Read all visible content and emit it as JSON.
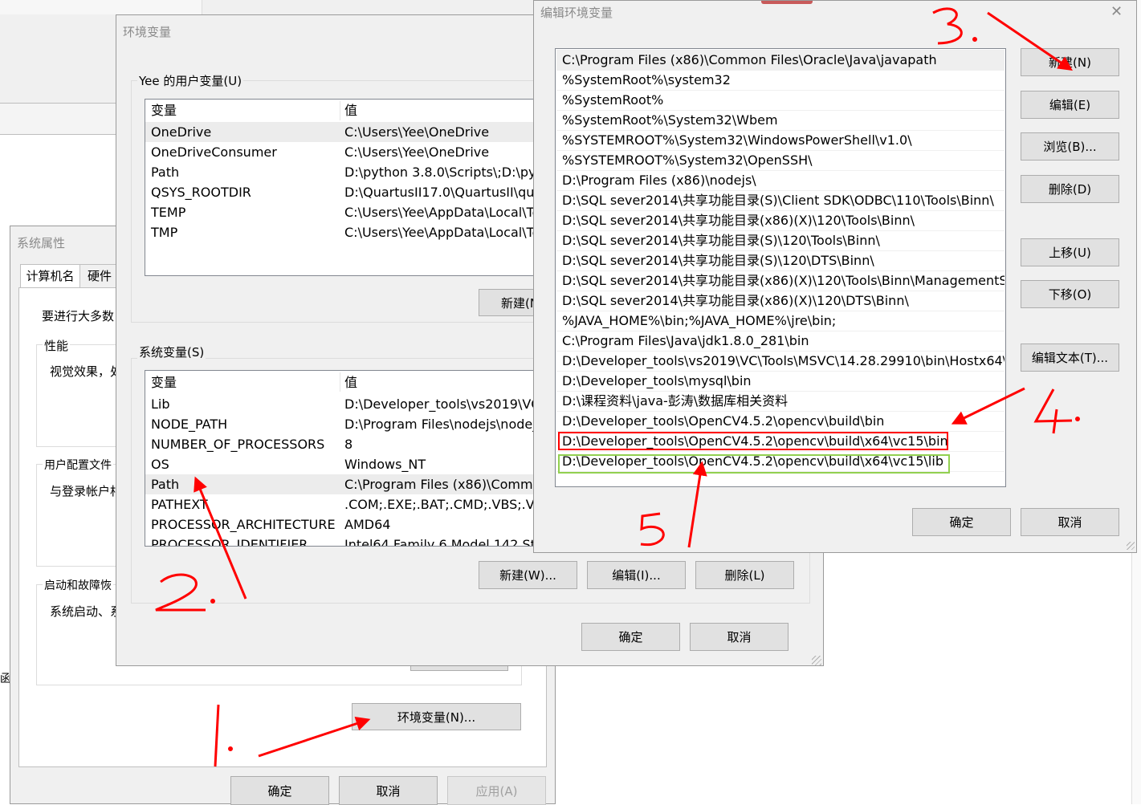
{
  "sys_props": {
    "title": "系统属性",
    "tabs": [
      "计算机名",
      "硬件"
    ],
    "intro": "要进行大多数",
    "perf_label": "性能",
    "perf_text": "视觉效果，处",
    "profile_label": "用户配置文件",
    "profile_text": "与登录帐户相",
    "startup_label": "启动和故障恢",
    "startup_text": "系统启动、系",
    "env_button": "环境变量(N)...",
    "ok": "确定",
    "cancel": "取消",
    "apply": "应用(A)",
    "left_edge_char": "函"
  },
  "env_vars": {
    "title": "环境变量",
    "user_group": "Yee 的用户变量(U)",
    "col_var": "变量",
    "col_val": "值",
    "user_rows": [
      {
        "name": "OneDrive",
        "value": "C:\\Users\\Yee\\OneDrive"
      },
      {
        "name": "OneDriveConsumer",
        "value": "C:\\Users\\Yee\\OneDrive"
      },
      {
        "name": "Path",
        "value": "D:\\python 3.8.0\\Scripts\\;D:\\pyth"
      },
      {
        "name": "QSYS_ROOTDIR",
        "value": "D:\\QuartusII17.0\\QuartusII\\qua"
      },
      {
        "name": "TEMP",
        "value": "C:\\Users\\Yee\\AppData\\Local\\Te"
      },
      {
        "name": "TMP",
        "value": "C:\\Users\\Yee\\AppData\\Local\\Te"
      }
    ],
    "user_new": "新建(N)",
    "sys_group": "系统变量(S)",
    "sys_rows": [
      {
        "name": "Lib",
        "value": "D:\\Developer_tools\\vs2019\\VC\\"
      },
      {
        "name": "NODE_PATH",
        "value": "D:\\Program Files\\nodejs\\node_"
      },
      {
        "name": "NUMBER_OF_PROCESSORS",
        "value": "8"
      },
      {
        "name": "OS",
        "value": "Windows_NT"
      },
      {
        "name": "Path",
        "value": "C:\\Program Files (x86)\\Commo"
      },
      {
        "name": "PATHEXT",
        "value": ".COM;.EXE;.BAT;.CMD;.VBS;.VBE"
      },
      {
        "name": "PROCESSOR_ARCHITECTURE",
        "value": "AMD64"
      },
      {
        "name": "PROCESSOR_IDENTIFIER",
        "value": "Intel64 Family 6 Model 142 Ste"
      }
    ],
    "sys_new": "新建(W)...",
    "sys_edit": "编辑(I)...",
    "sys_delete": "删除(L)",
    "ok": "确定",
    "cancel": "取消"
  },
  "edit_env": {
    "title": "编辑环境变量",
    "close": "✕",
    "paths": [
      "C:\\Program Files (x86)\\Common Files\\Oracle\\Java\\javapath",
      "%SystemRoot%\\system32",
      "%SystemRoot%",
      "%SystemRoot%\\System32\\Wbem",
      "%SYSTEMROOT%\\System32\\WindowsPowerShell\\v1.0\\",
      "%SYSTEMROOT%\\System32\\OpenSSH\\",
      "D:\\Program Files (x86)\\nodejs\\",
      "D:\\SQL sever2014\\共享功能目录(S)\\Client SDK\\ODBC\\110\\Tools\\Binn\\",
      "D:\\SQL sever2014\\共享功能目录(x86)(X)\\120\\Tools\\Binn\\",
      "D:\\SQL sever2014\\共享功能目录(S)\\120\\Tools\\Binn\\",
      "D:\\SQL sever2014\\共享功能目录(S)\\120\\DTS\\Binn\\",
      "D:\\SQL sever2014\\共享功能目录(x86)(X)\\120\\Tools\\Binn\\ManagementS...",
      "D:\\SQL sever2014\\共享功能目录(x86)(X)\\120\\DTS\\Binn\\",
      "%JAVA_HOME%\\bin;%JAVA_HOME%\\jre\\bin;",
      "C:\\Program Files\\Java\\jdk1.8.0_281\\bin",
      "D:\\Developer_tools\\vs2019\\VC\\Tools\\MSVC\\14.28.29910\\bin\\Hostx64\\...",
      "D:\\Developer_tools\\mysql\\bin",
      "D:\\课程资料\\java-彭涛\\数据库相关资料",
      "D:\\Developer_tools\\OpenCV4.5.2\\opencv\\build\\bin",
      "D:\\Developer_tools\\OpenCV4.5.2\\opencv\\build\\x64\\vc15\\bin",
      "D:\\Developer_tools\\OpenCV4.5.2\\opencv\\build\\x64\\vc15\\lib"
    ],
    "btn_new": "新建(N)",
    "btn_edit": "编辑(E)",
    "btn_browse": "浏览(B)...",
    "btn_delete": "删除(D)",
    "btn_up": "上移(U)",
    "btn_down": "下移(O)",
    "btn_edit_text": "编辑文本(T)...",
    "ok": "确定",
    "cancel": "取消"
  },
  "annotations": {
    "step1": "1.",
    "step2": "2.",
    "step3": "3.",
    "step4": "4.",
    "step5": "5",
    "arrow_color": "#ff0000",
    "red_box_color": "#ff0000",
    "green_box_color": "#92d050"
  }
}
